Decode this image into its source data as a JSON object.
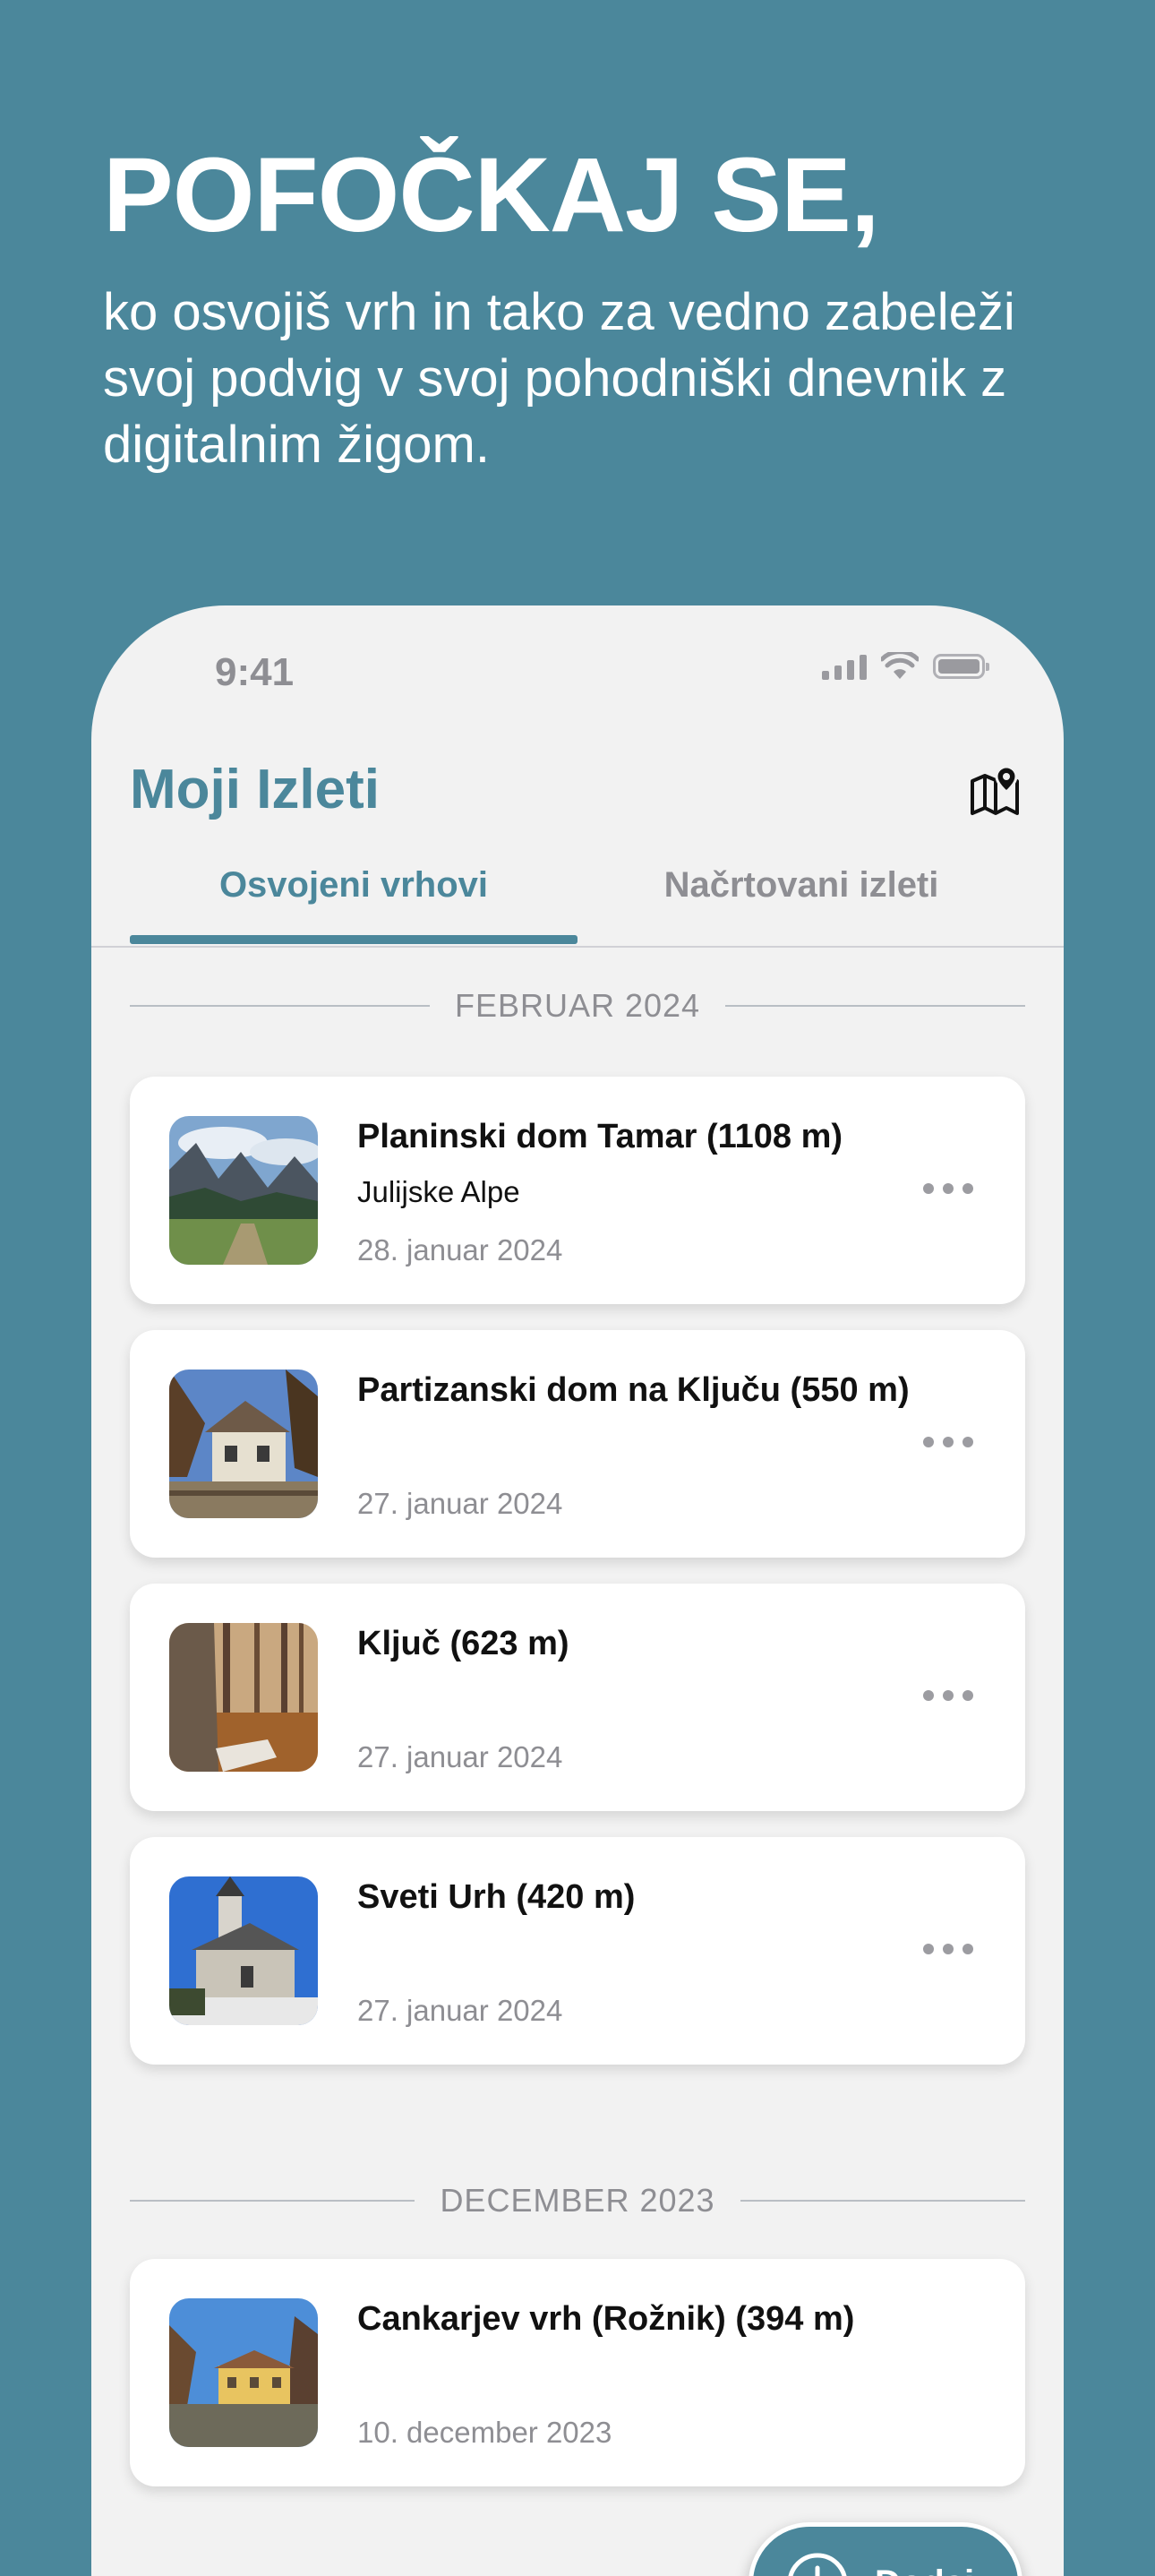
{
  "promo": {
    "title": "POFOČKAJ SE,",
    "subtitle": "ko osvojiš vrh in tako za vedno zabeleži svoj podvig v svoj pohodniški dnevnik z digitalnim žigom."
  },
  "status_bar": {
    "time": "9:41"
  },
  "header": {
    "title": "Moji Izleti",
    "map_icon": "map-pin-icon"
  },
  "tabs": [
    {
      "label": "Osvojeni vrhovi",
      "active": true
    },
    {
      "label": "Načrtovani izleti",
      "active": false
    }
  ],
  "sections": [
    {
      "label": "FEBRUAR 2024",
      "items": [
        {
          "title": "Planinski dom Tamar (1108 m)",
          "region": "Julijske Alpe",
          "date": "28. januar 2024"
        },
        {
          "title": "Partizanski dom na Ključu (550 m)",
          "region": "",
          "date": "27. januar 2024"
        },
        {
          "title": "Ključ (623 m)",
          "region": "",
          "date": "27. januar 2024"
        },
        {
          "title": "Sveti Urh (420 m)",
          "region": "",
          "date": "27. januar 2024"
        }
      ]
    },
    {
      "label": "DECEMBER 2023",
      "items": [
        {
          "title": "Cankarjev vrh (Rožnik) (394 m)",
          "region": "",
          "date": "10. december 2023"
        }
      ]
    }
  ],
  "fab": {
    "label": "Dodaj",
    "icon": "plus-circle-icon"
  },
  "colors": {
    "background": "#4b879b",
    "accent": "#4b879b",
    "card": "#ffffff",
    "muted": "#8e8e93"
  }
}
